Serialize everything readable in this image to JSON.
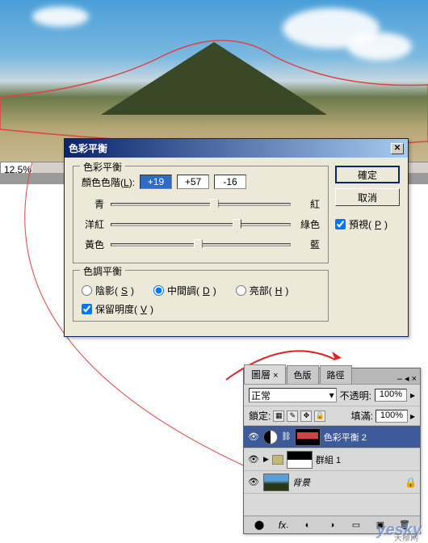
{
  "zoom": "12.5%",
  "dialog": {
    "title": "色彩平衡",
    "group1_title": "色彩平衡",
    "levels_label": "顏色色階(L):",
    "values": [
      "+19",
      "+57",
      "-16"
    ],
    "sliders": [
      {
        "left": "青",
        "right": "紅",
        "pos": 55
      },
      {
        "left": "洋紅",
        "right": "綠色",
        "pos": 68
      },
      {
        "left": "黃色",
        "right": "藍",
        "pos": 46
      }
    ],
    "group2_title": "色調平衡",
    "radios": {
      "shadows": "陰影(S)",
      "midtones": "中間調(D)",
      "highlights": "亮部(H)"
    },
    "preserve": "保留明度(V)",
    "ok": "確定",
    "cancel": "取消",
    "preview": "預視(P)"
  },
  "layers": {
    "tabs": [
      "圖層",
      "色版",
      "路徑"
    ],
    "blend": "正常",
    "opacity_label": "不透明:",
    "opacity": "100%",
    "lock_label": "鎖定:",
    "fill_label": "填滿:",
    "fill": "100%",
    "items": [
      {
        "name": "色彩平衡 2",
        "type": "adj"
      },
      {
        "name": "群組 1",
        "type": "group"
      },
      {
        "name": "背景",
        "type": "bg"
      }
    ]
  },
  "watermark": "yesky",
  "watermark_sub": "天極网"
}
